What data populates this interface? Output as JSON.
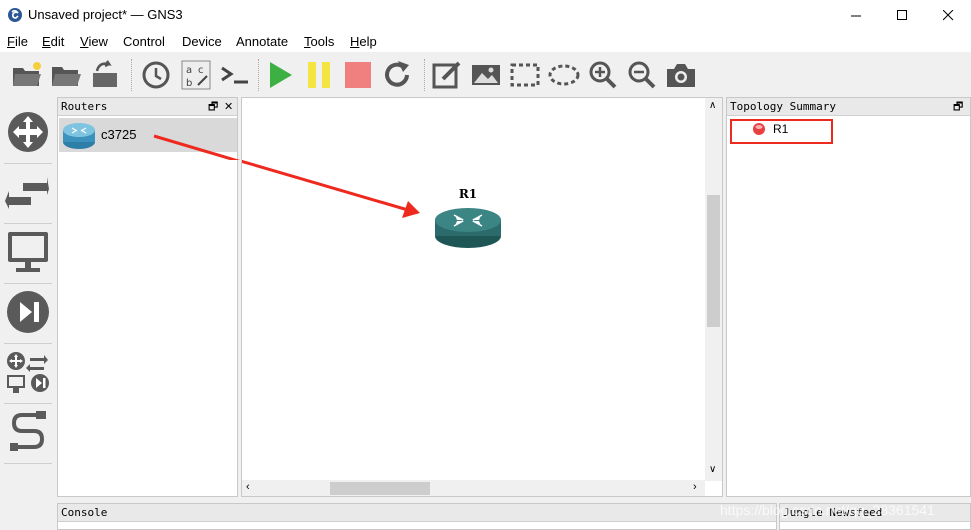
{
  "window": {
    "title": "Unsaved project* — GNS3",
    "controls": [
      "minimize",
      "maximize",
      "close"
    ]
  },
  "menu": [
    {
      "label": "File"
    },
    {
      "label": "Edit"
    },
    {
      "label": "View"
    },
    {
      "label": "Control"
    },
    {
      "label": "Device"
    },
    {
      "label": "Annotate"
    },
    {
      "label": "Tools"
    },
    {
      "label": "Help"
    }
  ],
  "toolbar": {
    "buttons": [
      "new-project-icon",
      "open-project-icon",
      "save-project-icon",
      "snapshot-clock-icon",
      "show-interface-labels-icon",
      "console-all-icon",
      "start-all-icon",
      "suspend-all-icon",
      "stop-all-icon",
      "reload-all-icon",
      "add-note-icon",
      "insert-picture-icon",
      "draw-rectangle-icon",
      "draw-ellipse-icon",
      "zoom-in-icon",
      "zoom-out-icon",
      "screenshot-icon"
    ],
    "colors": {
      "start": "#3cb043",
      "suspend": "#f4e542",
      "stop": "#f08080"
    }
  },
  "leftbar": {
    "buttons": [
      "routers-category-icon",
      "switches-category-icon",
      "end-devices-category-icon",
      "security-devices-category-icon",
      "all-devices-category-icon",
      "add-link-icon"
    ]
  },
  "routers_panel": {
    "title": "Routers",
    "items": [
      {
        "label": "c3725"
      }
    ]
  },
  "canvas": {
    "node": {
      "label": "R1"
    },
    "annotation_color": "#ee2a1f"
  },
  "topology_panel": {
    "title": "Topology Summary",
    "items": [
      {
        "label": "R1",
        "status_color": "#e84040"
      }
    ],
    "highlight_color": "#ee2a1f"
  },
  "console_panel": {
    "title": "Console"
  },
  "jungle_panel": {
    "title": "Jungle Newsfeed"
  },
  "watermark": "https://blog.csdn.net/qq_28361541"
}
